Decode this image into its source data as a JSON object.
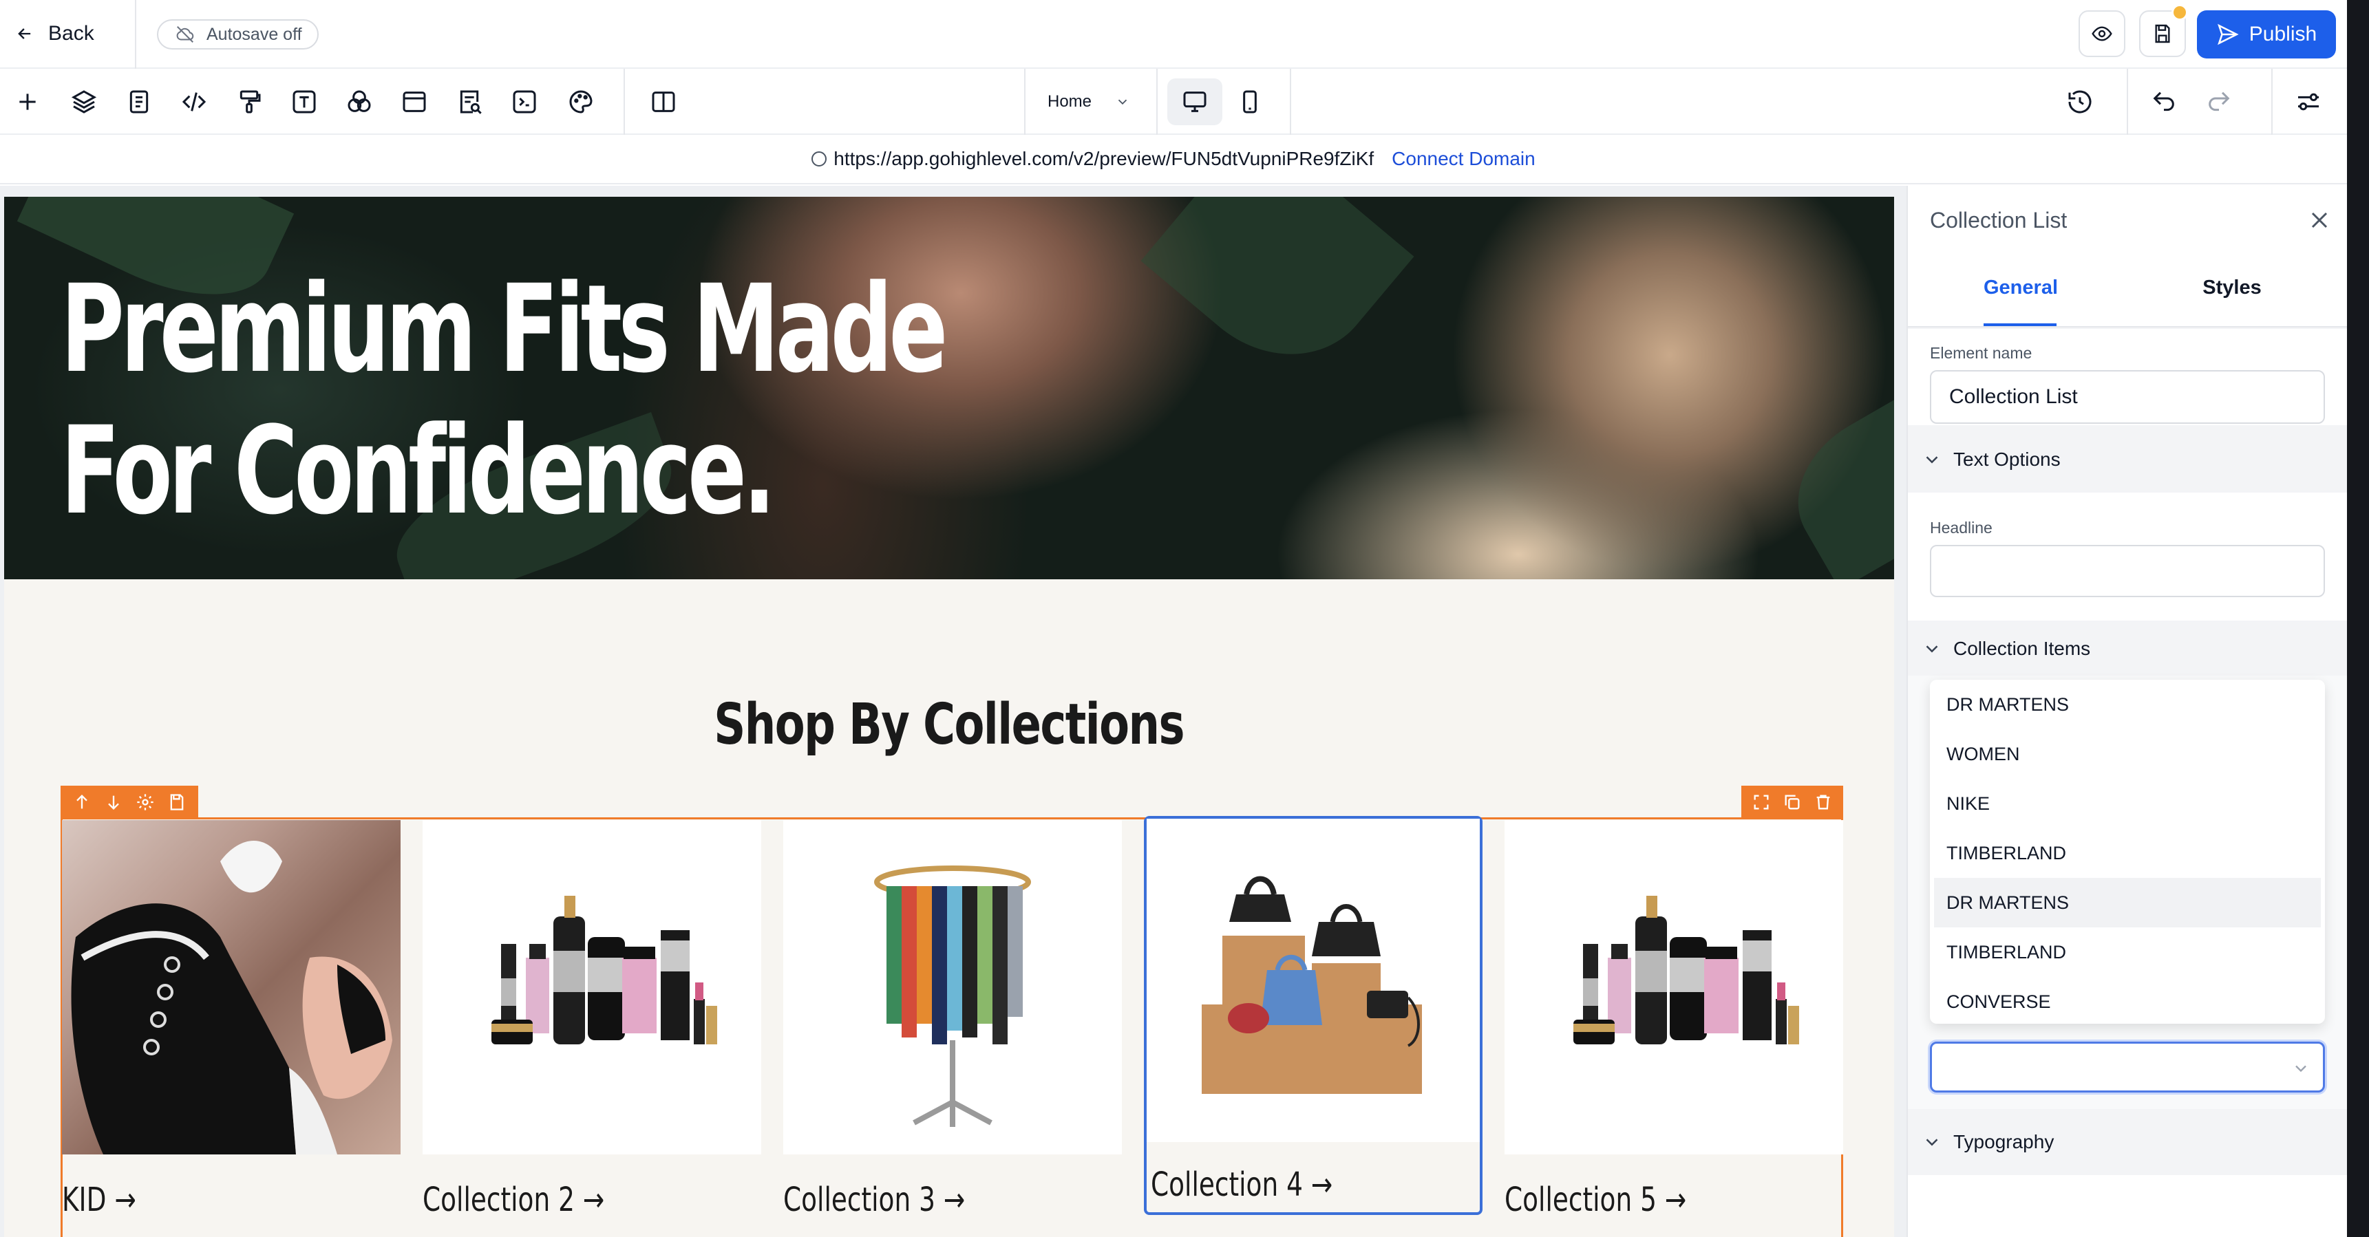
{
  "topbar": {
    "back_label": "Back",
    "autosave_label": "Autosave off",
    "publish_label": "Publish"
  },
  "toolbar": {
    "page_select_value": "Home",
    "tools": [
      "add-icon",
      "layers-icon",
      "pages-icon",
      "code-icon",
      "paint-roller-icon",
      "text-icon",
      "components-icon",
      "sections-icon",
      "form-icon",
      "terminal-icon",
      "palette-icon",
      "split-view-icon"
    ]
  },
  "urlbar": {
    "url": "https://app.gohighlevel.com/v2/preview/FUN5dtVupniPRe9fZiKf",
    "connect_label": "Connect Domain"
  },
  "page": {
    "hero_line1": "Premium Fits Made",
    "hero_line2": "For Confidence.",
    "section_title": "Shop By Collections",
    "collections": [
      {
        "label": "KID →"
      },
      {
        "label": "Collection 2 →"
      },
      {
        "label": "Collection 3 →"
      },
      {
        "label": "Collection 4 →"
      },
      {
        "label": "Collection 5 →"
      }
    ]
  },
  "panel": {
    "title": "Collection List",
    "tabs": [
      "General",
      "Styles"
    ],
    "element_name_label": "Element name",
    "element_name_value": "Collection List",
    "text_options_label": "Text Options",
    "headline_label": "Headline",
    "headline_value": "",
    "collection_items_label": "Collection Items",
    "dropdown_options": [
      "DR MARTENS",
      "WOMEN",
      "NIKE",
      "TIMBERLAND",
      "DR MARTENS",
      "TIMBERLAND",
      "CONVERSE"
    ],
    "typography_label": "Typography"
  },
  "colors": {
    "primary": "#1d5fea",
    "selection": "#f07b2a",
    "selected_card": "#3b6fd8",
    "notification": "#f6b73c"
  }
}
